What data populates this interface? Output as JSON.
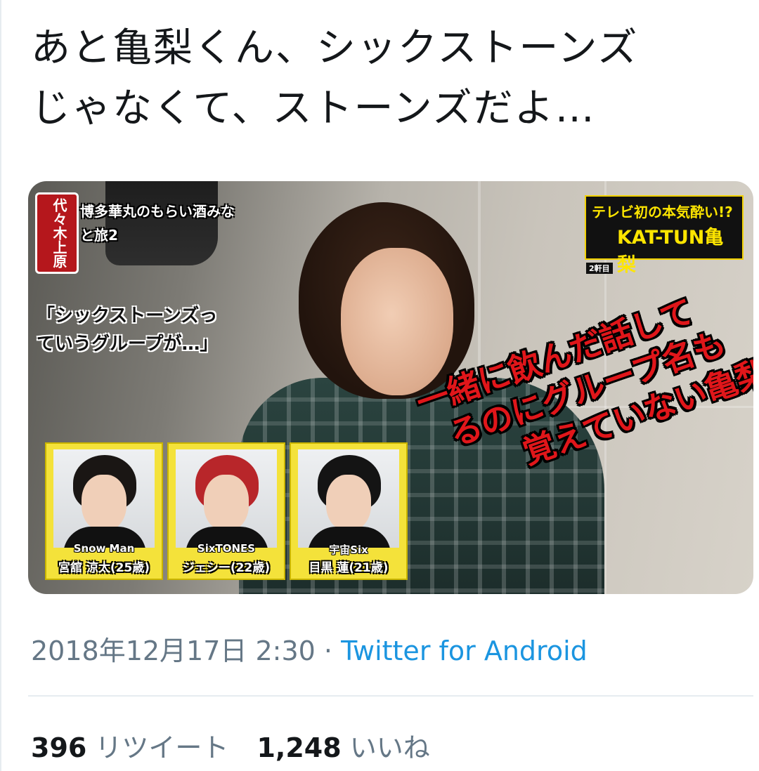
{
  "tweet": {
    "text_line1": "あと亀梨くん、シックストーンズ",
    "text_line2": "じゃなくて、ストーンズだよ…"
  },
  "media": {
    "logo_vertical": "代々木上原",
    "logo_title": "博多華丸のもらい酒みなと旅2",
    "caption_top": "テレビ初の本気酔い!?",
    "caption_main": "KAT-TUN亀梨",
    "caption_small": "2軒目",
    "quote_line1": "「シックストーンズっ",
    "quote_line2": "ていうグループが…」",
    "red_note_line1": "一緒に飲んだ話して",
    "red_note_line2": "るのにグループ名も",
    "red_note_line3": "覚えていない亀梨",
    "cards": [
      {
        "group": "Snow Man",
        "name": "宮舘 涼太(25歳)",
        "hair_color": "#1a1614"
      },
      {
        "group": "SixTONES",
        "name": "ジェシー(22歳)",
        "hair_color": "#b8262a"
      },
      {
        "group": "宇宙Six",
        "name": "目黒 蓮(21歳)",
        "hair_color": "#141414"
      }
    ]
  },
  "meta": {
    "timestamp": "2018年12月17日 2:30",
    "separator": " · ",
    "source": "Twitter for Android"
  },
  "stats": {
    "retweets_count": "396",
    "retweets_label": "リツイート",
    "likes_count": "1,248",
    "likes_label": "いいね"
  },
  "colors": {
    "text": "#14171a",
    "secondary": "#657786",
    "link": "#1b95e0"
  }
}
